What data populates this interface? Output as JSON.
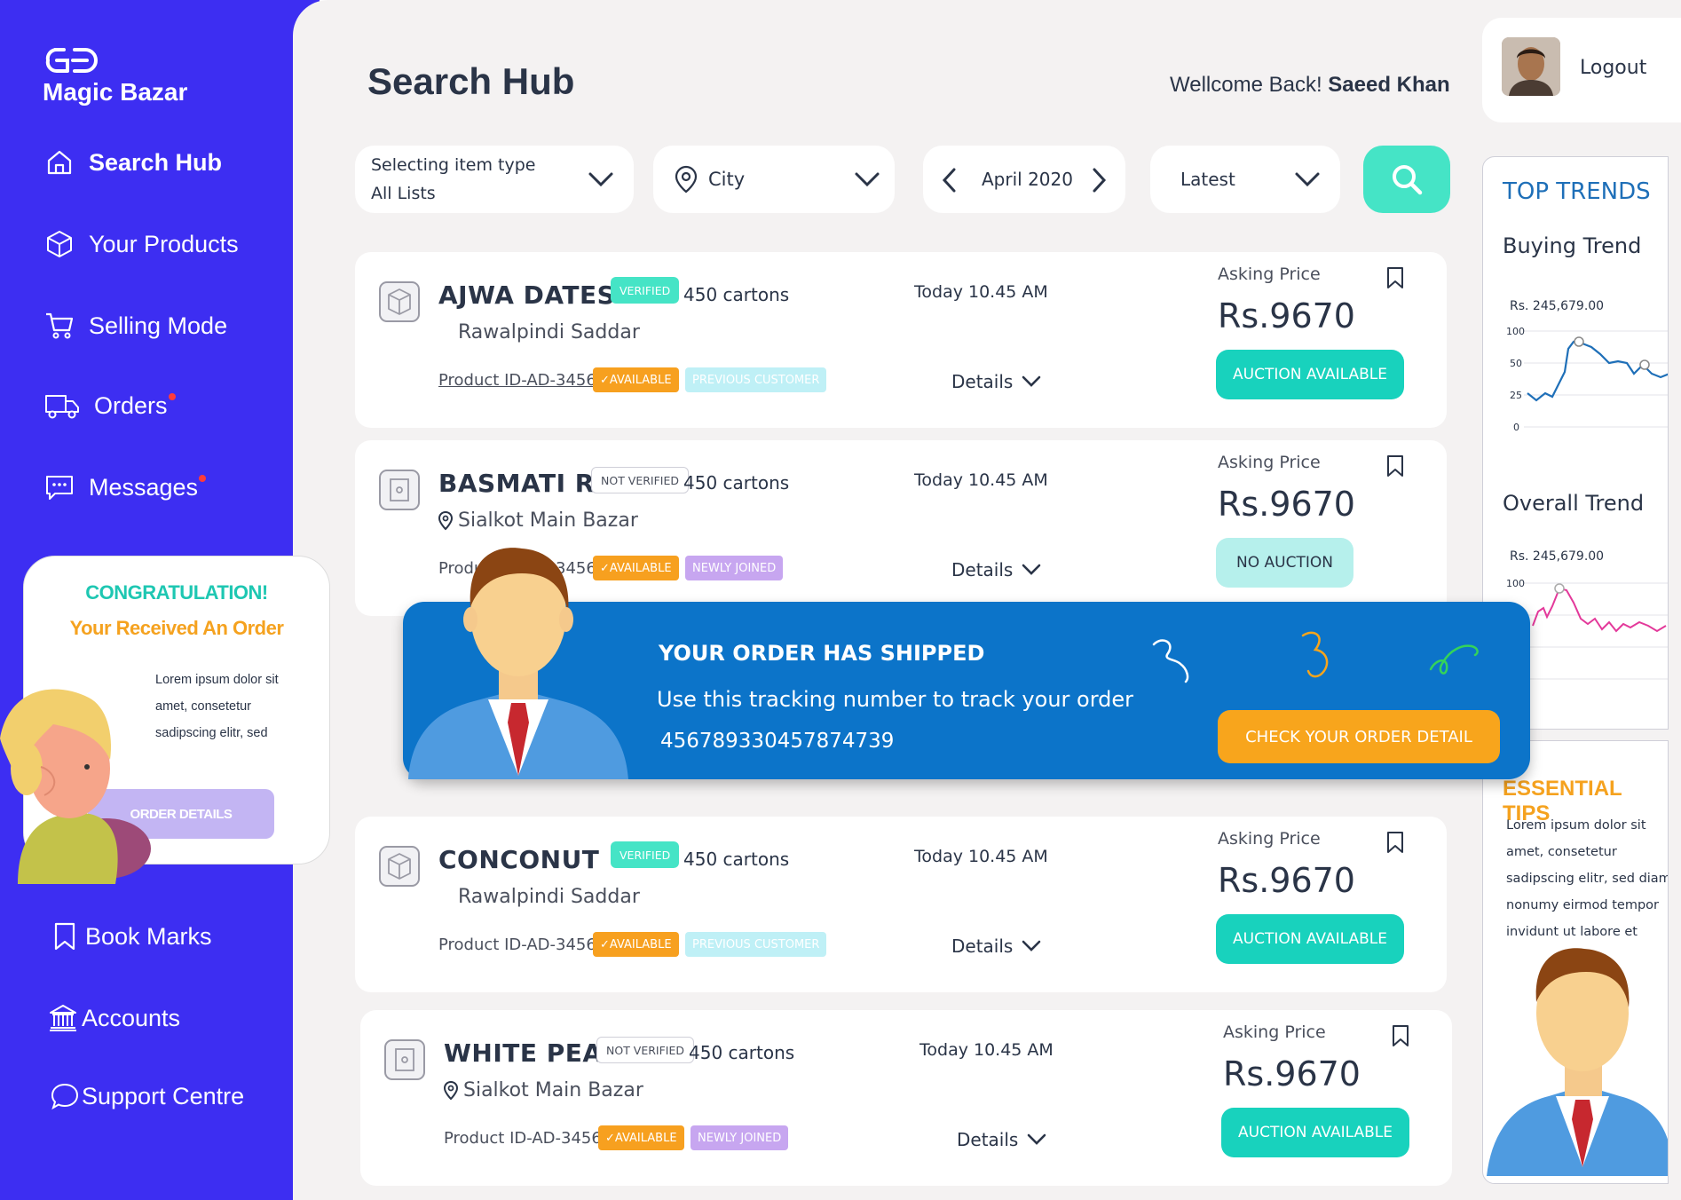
{
  "app": {
    "name": "Magic Bazar"
  },
  "sidebar": {
    "items": [
      {
        "label": "Search Hub",
        "icon": "home-icon",
        "active": true
      },
      {
        "label": "Your Products",
        "icon": "box-icon"
      },
      {
        "label": "Selling Mode",
        "icon": "cart-icon"
      },
      {
        "label": "Orders",
        "icon": "truck-icon",
        "badge": true
      },
      {
        "label": "Messages",
        "icon": "message-icon",
        "badge": true
      },
      {
        "label": "Book Marks",
        "icon": "bookmark-icon"
      },
      {
        "label": "Accounts",
        "icon": "bank-icon"
      },
      {
        "label": "Support Centre",
        "icon": "chat-bubble-icon"
      }
    ]
  },
  "header": {
    "title": "Search Hub",
    "welcome_prefix": "Wellcome Back!",
    "user_name": "Saeed Khan",
    "logout": "Logout"
  },
  "filters": {
    "item_type_label": "Selecting item type",
    "item_type_value": "All Lists",
    "city": "City",
    "month": "April 2020",
    "sort": "Latest"
  },
  "products": [
    {
      "name": "AJWA DATES",
      "location": "Rawalpindi Saddar",
      "show_pin": false,
      "verified": "VERIFIED",
      "verified_ok": true,
      "quantity": "450 cartons",
      "time": "Today 10.45 AM",
      "product_id": "Product ID-AD-34566",
      "available": "✓AVAILABLE",
      "tag": "PREVIOUS CUSTOMER",
      "tag_type": "prev",
      "details": "Details",
      "asking_label": "Asking Price",
      "price": "Rs.9670",
      "auction": "AUCTION AVAILABLE",
      "auction_ok": true
    },
    {
      "name": "BASMATI RICE",
      "location": "Sialkot Main Bazar",
      "show_pin": true,
      "verified": "NOT VERIFIED",
      "verified_ok": false,
      "quantity": "450 cartons",
      "time": "Today 10.45 AM",
      "product_id": "Product ID-AD-34566",
      "available": "✓AVAILABLE",
      "tag": "NEWLY JOINED",
      "tag_type": "new",
      "details": "Details",
      "asking_label": "Asking Price",
      "price": "Rs.9670",
      "auction": "NO AUCTION",
      "auction_ok": false
    },
    {
      "name": "CONCONUT",
      "location": "Rawalpindi Saddar",
      "show_pin": false,
      "verified": "VERIFIED",
      "verified_ok": true,
      "quantity": "450 cartons",
      "time": "Today 10.45 AM",
      "product_id": "Product ID-AD-34566",
      "available": "✓AVAILABLE",
      "tag": "PREVIOUS CUSTOMER",
      "tag_type": "prev",
      "details": "Details",
      "asking_label": "Asking Price",
      "price": "Rs.9670",
      "auction": "AUCTION AVAILABLE",
      "auction_ok": true
    },
    {
      "name": "WHITE PEASE",
      "location": "Sialkot Main Bazar",
      "show_pin": true,
      "verified": "NOT VERIFIED",
      "verified_ok": false,
      "quantity": "450 cartons",
      "time": "Today 10.45 AM",
      "product_id": "Product ID-AD-34566",
      "available": "✓AVAILABLE",
      "tag": "NEWLY JOINED",
      "tag_type": "new",
      "details": "Details",
      "asking_label": "Asking Price",
      "price": "Rs.9670",
      "auction": "AUCTION AVAILABLE",
      "auction_ok": true
    }
  ],
  "congrats": {
    "title": "CONGRATULATION!",
    "subtitle": "Your Received An Order",
    "text": "Lorem ipsum dolor sit amet, consetetur sadipscing elitr, sed",
    "button": "ORDER DETAILS"
  },
  "shipped": {
    "title": "YOUR ORDER HAS SHIPPED",
    "line": "Use this tracking number to track your order",
    "tracking_number": "456789330457874739",
    "button": "CHECK YOUR ORDER DETAIL"
  },
  "trends": {
    "title": "TOP TRENDS",
    "buying": {
      "label": "Buying Trend",
      "amount": "Rs.  245,679.00",
      "ticks": [
        "100",
        "50",
        "25",
        "0"
      ]
    },
    "overall": {
      "label": "Overall Trend",
      "amount": "Rs.  245,679.00",
      "ticks": [
        "100"
      ]
    }
  },
  "tips": {
    "title": "ESSENTIAL TIPS",
    "text": "Lorem ipsum dolor sit amet, consetetur sadipscing elitr, sed diam nonumy eirmod tempor invidunt ut labore et"
  },
  "colors": {
    "sidebar": "#3d2ef2",
    "accent": "#45e4c6",
    "orange": "#f7a01f",
    "banner": "#0c74c9"
  }
}
